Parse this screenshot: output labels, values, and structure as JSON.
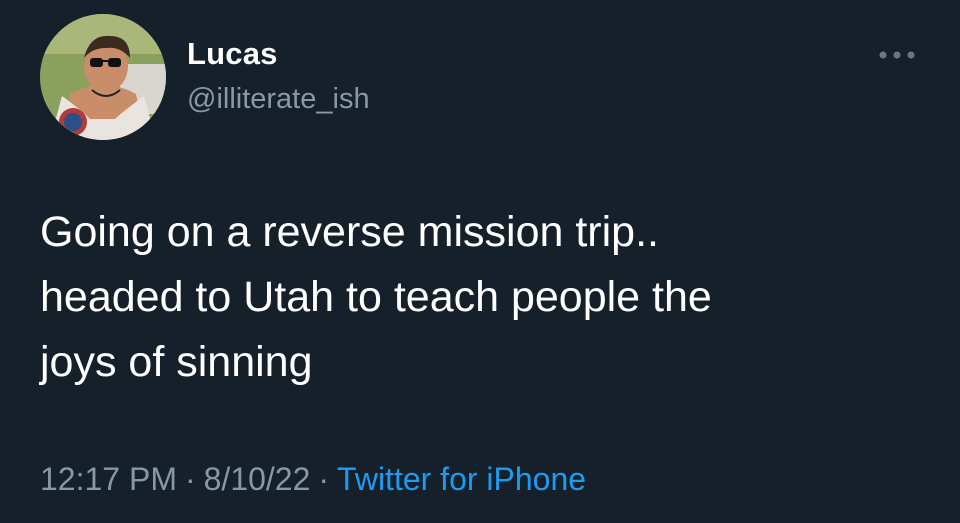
{
  "user": {
    "display_name": "Lucas",
    "handle": "@illiterate_ish",
    "avatar_icon": "profile-photo"
  },
  "menu": {
    "more_icon": "more-horizontal-icon"
  },
  "tweet": {
    "text": "Going on a reverse mission trip..\nheaded to Utah to teach people the\njoys of sinning",
    "time": "12:17 PM",
    "separator": "·",
    "date": "8/10/22",
    "source": "Twitter for iPhone"
  },
  "colors": {
    "background": "#15202b",
    "primary_text": "#ffffff",
    "secondary_text": "#8899a6",
    "link": "#1d9bf0"
  }
}
